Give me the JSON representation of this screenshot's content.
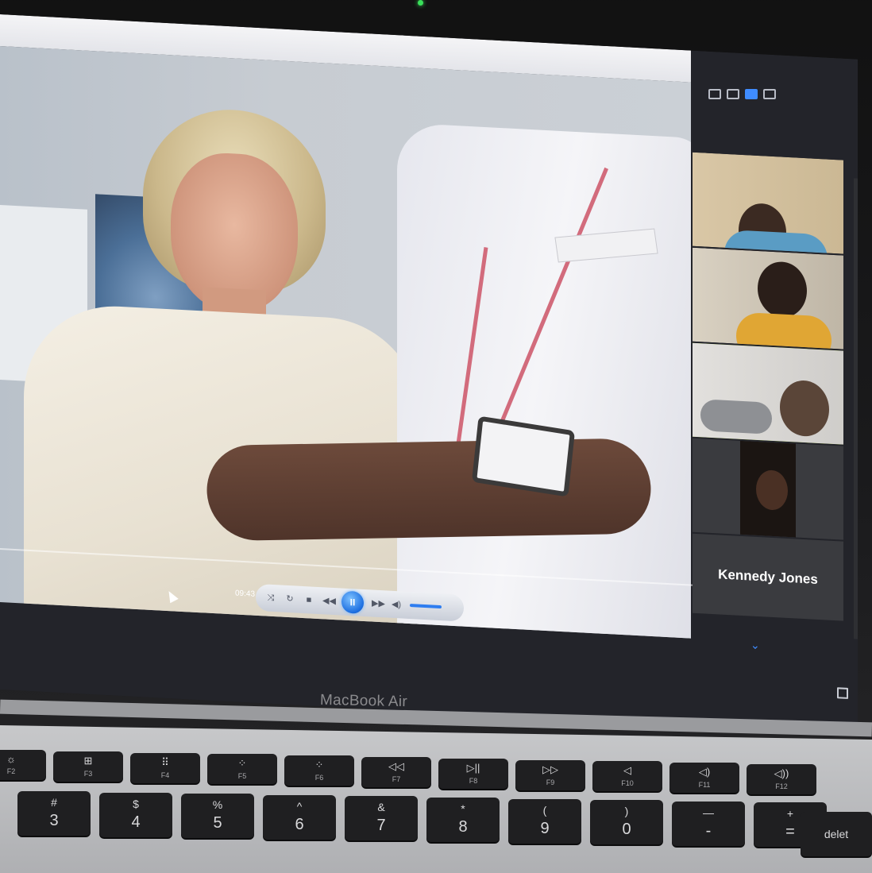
{
  "device": {
    "brand_label": "MacBook Air"
  },
  "player": {
    "elapsed_time": "09:43",
    "state": "playing",
    "volume_fraction": 1.0,
    "controls": [
      "shuffle-icon",
      "repeat-icon",
      "stop-icon",
      "previous-icon",
      "pause-icon",
      "next-icon",
      "volume-icon"
    ]
  },
  "meeting": {
    "view_controls": [
      "minimize-icon",
      "speaker-view-icon",
      "sidebar-view-icon",
      "gallery-view-icon"
    ],
    "active_view": "sidebar-view-icon",
    "participants": [
      {
        "video": true,
        "highlighted": false
      },
      {
        "video": true,
        "highlighted": false
      },
      {
        "video": true,
        "highlighted": true
      },
      {
        "video": true,
        "highlighted": false
      },
      {
        "video": false,
        "name": "Kennedy Jones"
      }
    ],
    "scroll_icon": "chevron-down-icon"
  },
  "keyboard": {
    "function_row": [
      {
        "icon": "☼",
        "label": "F2"
      },
      {
        "icon": "⊞",
        "label": "F3"
      },
      {
        "icon": "⠿",
        "label": "F4"
      },
      {
        "icon": "⁘",
        "label": "F5"
      },
      {
        "icon": "⁘",
        "label": "F6"
      },
      {
        "icon": "◁◁",
        "label": "F7"
      },
      {
        "icon": "▷||",
        "label": "F8"
      },
      {
        "icon": "▷▷",
        "label": "F9"
      },
      {
        "icon": "◁",
        "label": "F10"
      },
      {
        "icon": "◁)",
        "label": "F11"
      },
      {
        "icon": "◁))",
        "label": "F12"
      }
    ],
    "number_row": [
      {
        "upper": "#",
        "lower": "3"
      },
      {
        "upper": "$",
        "lower": "4"
      },
      {
        "upper": "%",
        "lower": "5"
      },
      {
        "upper": "^",
        "lower": "6"
      },
      {
        "upper": "&",
        "lower": "7"
      },
      {
        "upper": "*",
        "lower": "8"
      },
      {
        "upper": "(",
        "lower": "9"
      },
      {
        "upper": ")",
        "lower": "0"
      },
      {
        "upper": "—",
        "lower": "-"
      },
      {
        "upper": "+",
        "lower": "="
      }
    ],
    "delete_label": "delet"
  }
}
